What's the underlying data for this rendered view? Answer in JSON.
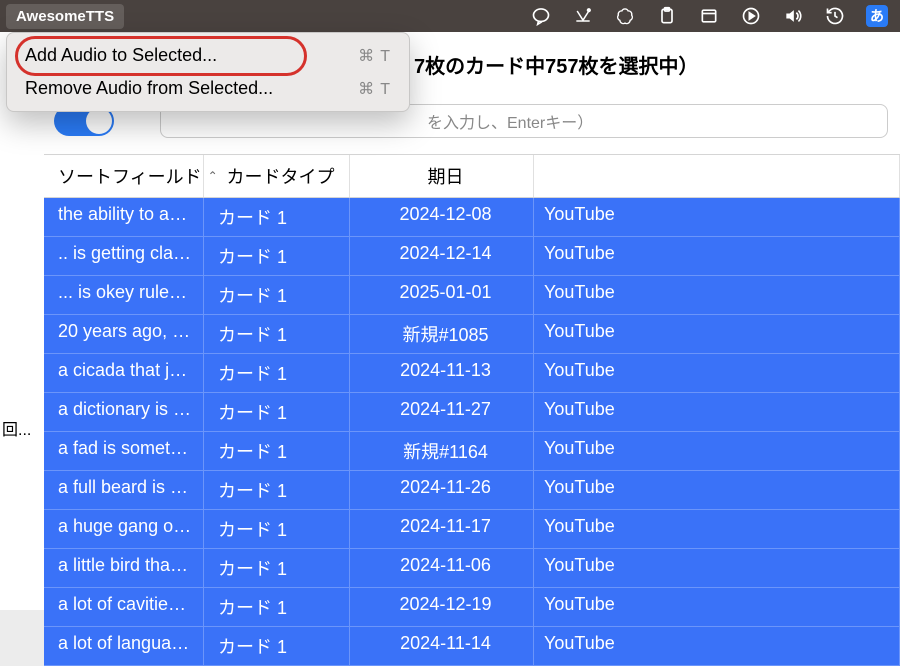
{
  "menubar": {
    "app_name": "AwesomeTTS",
    "ime_char": "あ"
  },
  "dropdown": {
    "items": [
      {
        "label": "Add Audio to Selected...",
        "shortcut": "⌘ T"
      },
      {
        "label": "Remove Audio from Selected...",
        "shortcut": "⌘ T"
      }
    ]
  },
  "header": {
    "selection_text": "7枚のカード中757枚を選択中）"
  },
  "search": {
    "hint": "を入力し、Enterキー）"
  },
  "side_label": "回...",
  "table": {
    "columns": {
      "sortfield": "ソートフィールド",
      "cardtype": "カードタイプ",
      "due": "期日"
    },
    "sort_indicator": "⌃",
    "rows": [
      {
        "sort": "the ability to a…",
        "type": "カード 1",
        "due": "2024-12-08",
        "deck": "YouTube"
      },
      {
        "sort": ".. is getting cla…",
        "type": "カード 1",
        "due": "2024-12-14",
        "deck": "YouTube"
      },
      {
        "sort": "... is okey rule…",
        "type": "カード 1",
        "due": "2025-01-01",
        "deck": "YouTube"
      },
      {
        "sort": "20 years ago, …",
        "type": "カード 1",
        "due": "新規#1085",
        "deck": "YouTube"
      },
      {
        "sort": "a cicada that j…",
        "type": "カード 1",
        "due": "2024-11-13",
        "deck": "YouTube"
      },
      {
        "sort": "a dictionary is …",
        "type": "カード 1",
        "due": "2024-11-27",
        "deck": "YouTube"
      },
      {
        "sort": "a fad is somet…",
        "type": "カード 1",
        "due": "新規#1164",
        "deck": "YouTube"
      },
      {
        "sort": "a full beard is …",
        "type": "カード 1",
        "due": "2024-11-26",
        "deck": "YouTube"
      },
      {
        "sort": "a huge gang o…",
        "type": "カード 1",
        "due": "2024-11-17",
        "deck": "YouTube"
      },
      {
        "sort": "a little bird tha…",
        "type": "カード 1",
        "due": "2024-11-06",
        "deck": "YouTube"
      },
      {
        "sort": "a lot of cavitie…",
        "type": "カード 1",
        "due": "2024-12-19",
        "deck": "YouTube"
      },
      {
        "sort": "a lot of langua…",
        "type": "カード 1",
        "due": "2024-11-14",
        "deck": "YouTube"
      }
    ]
  }
}
